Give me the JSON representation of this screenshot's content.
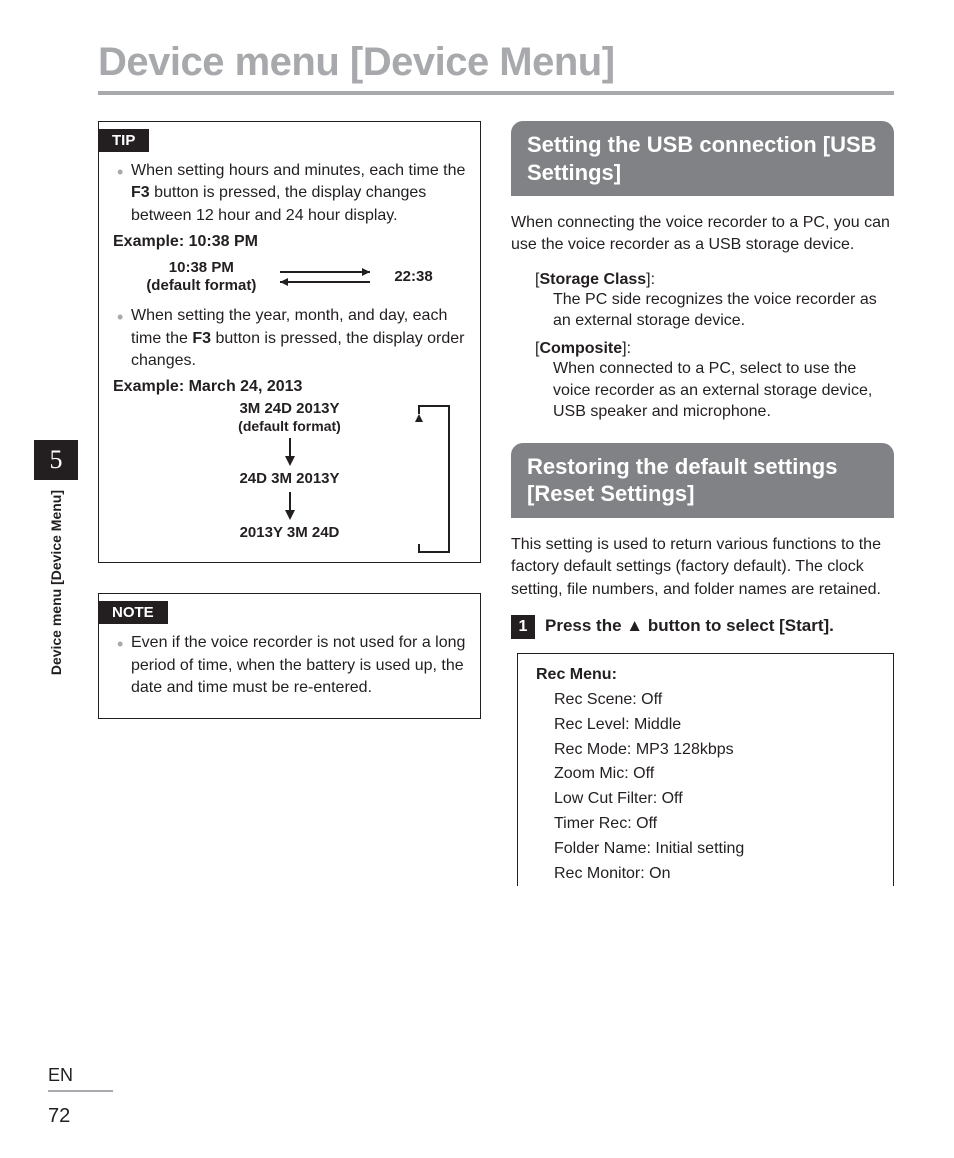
{
  "page_title": "Device menu [Device Menu]",
  "sidetab": {
    "number": "5",
    "text": "Device menu [Device Menu]"
  },
  "footer": {
    "lang": "EN",
    "page": "72"
  },
  "tip": {
    "label": "TIP",
    "item1_pre": "When setting hours and minutes, each time the ",
    "item1_btn": "F3",
    "item1_post": " button is pressed, the display changes between 12 hour and 24 hour display.",
    "ex1_title": "Example: 10:38 PM",
    "ex1_left1": "10:38 PM",
    "ex1_left2": "(default format)",
    "ex1_right": "22:38",
    "item2_pre": "When setting the year, month, and day, each time the ",
    "item2_btn": "F3",
    "item2_post": " button is pressed, the display order changes.",
    "ex2_title": "Example: March 24, 2013",
    "ex2_fmt1": "3M 24D 2013Y",
    "ex2_sub": "(default format)",
    "ex2_fmt2": "24D 3M 2013Y",
    "ex2_fmt3": "2013Y 3M 24D"
  },
  "note": {
    "label": "NOTE",
    "item": "Even if the voice recorder is not used for a long period of time, when the battery is used up, the date and time must be re-entered."
  },
  "usb": {
    "heading": "Setting the USB connection [USB Settings]",
    "intro": "When connecting the voice recorder to a PC, you can use the voice recorder as a USB storage device.",
    "term1": "Storage Class",
    "desc1": "The PC side recognizes the voice recorder as an external storage device.",
    "term2": "Composite",
    "desc2": "When connected to a PC, select to use the voice recorder as an external storage device, USB speaker and microphone."
  },
  "reset": {
    "heading": "Restoring the default settings [Reset Settings]",
    "intro": "This setting is used to return various functions to the factory default settings (factory default). The clock setting, file numbers, and folder names are retained.",
    "step_num": "1",
    "step_pre": "Press the ",
    "step_icon": "▲",
    "step_mid": " button to select [",
    "step_start": "Start",
    "step_post": "].",
    "rec_title": "Rec Menu:",
    "rec_items": [
      "Rec Scene: Off",
      "Rec Level: Middle",
      "Rec Mode: MP3 128kbps",
      "Zoom Mic: Off",
      "Low Cut Filter: Off",
      "Timer Rec: Off",
      "Folder Name: Initial setting",
      "Rec Monitor: On"
    ]
  }
}
